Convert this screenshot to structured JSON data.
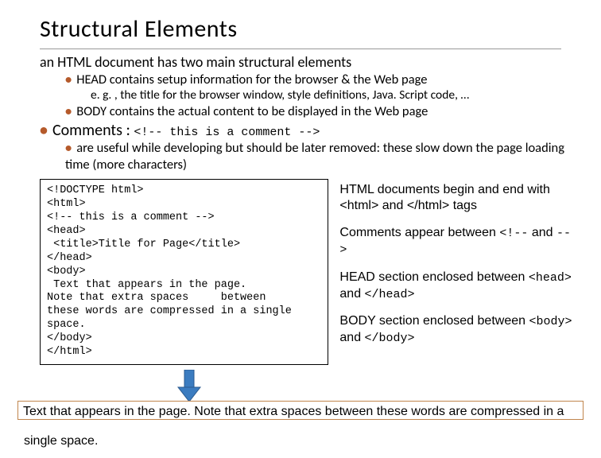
{
  "title": "Structural Elements",
  "intro": "an HTML document has two main structural elements",
  "bullets": {
    "head": "HEAD contains setup information for the browser & the Web page",
    "head_eg": "e. g. , the title for the browser window, style definitions, Java. Script code, …",
    "body": "BODY contains the actual content to be displayed in the Web page",
    "comments_label": "Comments : ",
    "comments_code": "<!-- this is a comment -->",
    "comments_sub": "are useful while developing but should be later removed: these slow down the page loading time (more characters)"
  },
  "code": "<!DOCTYPE html>\n<html>\n<!-- this is a comment -->\n<head>\n <title>Title for Page</title>\n</head>\n<body>\n Text that appears in the page.\nNote that extra spaces     between\nthese words are compressed in a single\nspace.\n</body>\n</html>",
  "right": {
    "p1a": "HTML documents begin and end with ",
    "p1_tag1": "<html>",
    "p1_and": " and ",
    "p1_tag2": "</html>",
    "p1b": " tags",
    "p2a": "Comments appear between ",
    "p2_tag1": "<!--",
    "p2_and": " and ",
    "p2_tag2": "-->",
    "p3a": "HEAD section enclosed between ",
    "p3_tag1": "<head>",
    "p3_and": " and ",
    "p3_tag2": "</head>",
    "p4a": "BODY section enclosed between ",
    "p4_tag1": "<body>",
    "p4_and": " and ",
    "p4_tag2": "</body>"
  },
  "output_line1": "Text that appears in the page. Note that extra spaces between these words are compressed in a",
  "output_line2": "single space."
}
